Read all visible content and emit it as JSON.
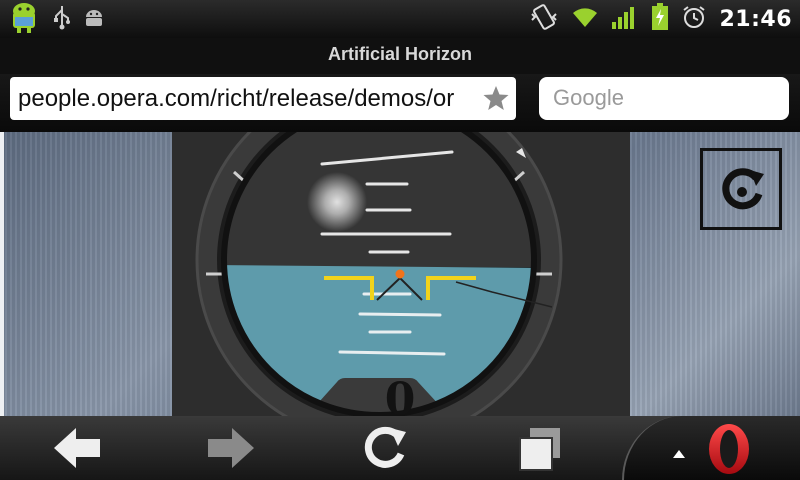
{
  "status_bar": {
    "clock": "21:46",
    "left_icons": [
      "android-icon",
      "usb-icon",
      "debug-icon"
    ],
    "right_icons": [
      "vibrate-icon",
      "wifi-icon",
      "signal-icon",
      "battery-charging-icon",
      "alarm-icon"
    ],
    "accent_color": "#9ad12e"
  },
  "window": {
    "title": "Artificial Horizon"
  },
  "address_bar": {
    "url": "people.opera.com/richt/release/demos/or",
    "search_placeholder": "Google"
  },
  "page": {
    "instrument": {
      "readout": "0",
      "sky_color": "#3a3a3a",
      "ground_color": "#5e9bab",
      "aircraft_marker_color": "#f2d31b"
    },
    "reload_icon": "reload-icon"
  },
  "toolbar": {
    "buttons": [
      "back-icon",
      "forward-icon",
      "reload-icon",
      "tabs-icon",
      "opera-menu-icon"
    ],
    "opera_color": "#d9141d"
  }
}
